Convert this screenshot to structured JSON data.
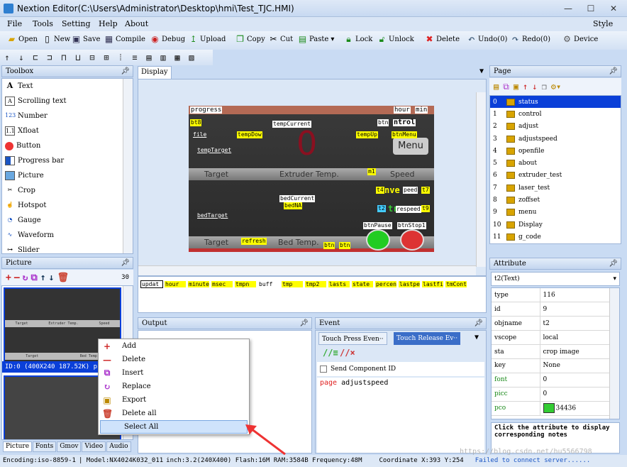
{
  "window": {
    "title": "Nextion Editor(C:\\Users\\Administrator\\Desktop\\hmi\\Test_TJC.HMI)"
  },
  "menu": {
    "items": [
      "File",
      "Tools",
      "Setting",
      "Help",
      "About"
    ],
    "style": "Style"
  },
  "toolbar": {
    "open": "Open",
    "new": "New",
    "save": "Save",
    "compile": "Compile",
    "debug": "Debug",
    "upload": "Upload",
    "copy": "Copy",
    "cut": "Cut",
    "paste": "Paste",
    "lock": "Lock",
    "unlock": "Unlock",
    "delete": "Delete",
    "undo": "Undo(0)",
    "redo": "Redo(0)",
    "device": "Device"
  },
  "toolbox": {
    "title": "Toolbox",
    "items": [
      "Text",
      "Scrolling text",
      "Number",
      "Xfloat",
      "Button",
      "Progress bar",
      "Picture",
      "Crop",
      "Hotspot",
      "Gauge",
      "Waveform",
      "Slider"
    ]
  },
  "picture": {
    "title": "Picture",
    "count": "30",
    "info": "ID:0  (400X240 187.52K) pr",
    "thumb_labels": [
      "Target",
      "Extruder Temp.",
      "Speed",
      "Target",
      "Bed Temp."
    ]
  },
  "context_menu": [
    "Add",
    "Delete",
    "Insert",
    "Replace",
    "Export",
    "Delete all",
    "Select All"
  ],
  "display": {
    "tab": "Display",
    "labels": {
      "progress": "progress",
      "hour": "hour",
      "min": "min",
      "bt8": "bt8",
      "tempCurrent": "tempCurrent",
      "btn": "btn",
      "control": "ntrol",
      "file": "file",
      "tempDown": "tempDow",
      "tempUp": "tempUp",
      "btnMenu": "btnMenu",
      "menu": "Menu",
      "tempTarget": "tempTarget",
      "target1": "Target",
      "extruder": "Extruder Temp.",
      "speed": "Speed",
      "m1": "m1",
      "t4": "t4",
      "speedTxt": "peed",
      "t7": "t7",
      "bedCurrent": "bedCurrent",
      "bedNA": "bedNA",
      "bedTarget": "bedTarget",
      "t2": "t2",
      "respeed": "respeed",
      "t9": "t9",
      "btnPause": "btnPause",
      "btnStop": "btnStop1",
      "target2": "Target",
      "refresh": "refresh",
      "bedTemp": "Bed Temp.",
      "btn2": "btn",
      "btn3": "btn",
      "zero": "0",
      "move": "nve",
      "tr": "tr"
    },
    "bottom_vars": [
      "updat",
      "hour",
      "minute",
      "msec",
      "tmpn",
      "buff",
      "tmp",
      "tmp2",
      "lasts",
      "state",
      "percen",
      "lastpe",
      "lastfi",
      "tmCont"
    ]
  },
  "output": {
    "title": "Output"
  },
  "event": {
    "title": "Event",
    "tab_press": "Touch Press Even··",
    "tab_release": "Touch Release Ev··",
    "send_id": "Send Component ID",
    "code_kw": "page",
    "code_arg": "adjustspeed"
  },
  "page": {
    "title": "Page",
    "items": [
      {
        "n": "0",
        "name": "status"
      },
      {
        "n": "1",
        "name": "control"
      },
      {
        "n": "2",
        "name": "adjust"
      },
      {
        "n": "3",
        "name": "adjustspeed"
      },
      {
        "n": "4",
        "name": "openfile"
      },
      {
        "n": "5",
        "name": "about"
      },
      {
        "n": "6",
        "name": "extruder_test"
      },
      {
        "n": "7",
        "name": "laser_test"
      },
      {
        "n": "8",
        "name": "zoffset"
      },
      {
        "n": "9",
        "name": "menu"
      },
      {
        "n": "10",
        "name": "Display"
      },
      {
        "n": "11",
        "name": "g_code"
      }
    ]
  },
  "attribute": {
    "title": "Attribute",
    "selected": "t2(Text)",
    "rows": [
      [
        "type",
        "116"
      ],
      [
        "id",
        "9"
      ],
      [
        "objname",
        "t2"
      ],
      [
        "vscope",
        "local"
      ],
      [
        "sta",
        "crop image"
      ],
      [
        "key",
        "None"
      ],
      [
        "font",
        "0"
      ],
      [
        "picc",
        "0"
      ],
      [
        "pco",
        "34436"
      ]
    ],
    "hint": "Click the attribute to display corresponding notes"
  },
  "bottom_tabs": [
    "Picture",
    "Fonts",
    "Gmov",
    "Video",
    "Audio"
  ],
  "status": {
    "encoding": "Encoding:iso-8859-1",
    "model": "| Model:NX4024K032_011",
    "inch": "inch:3.2(240X400) Flash:16M RAM:3584B Frequency:48M",
    "coord": "Coordinate X:393  Y:254",
    "conn": "Failed to connect server......",
    "watermark": "https://blog.csdn.net/hu5566798"
  },
  "colors": {
    "accent": "#1a55c4",
    "select": "#0a3fd8",
    "pco": "#33cc33"
  }
}
